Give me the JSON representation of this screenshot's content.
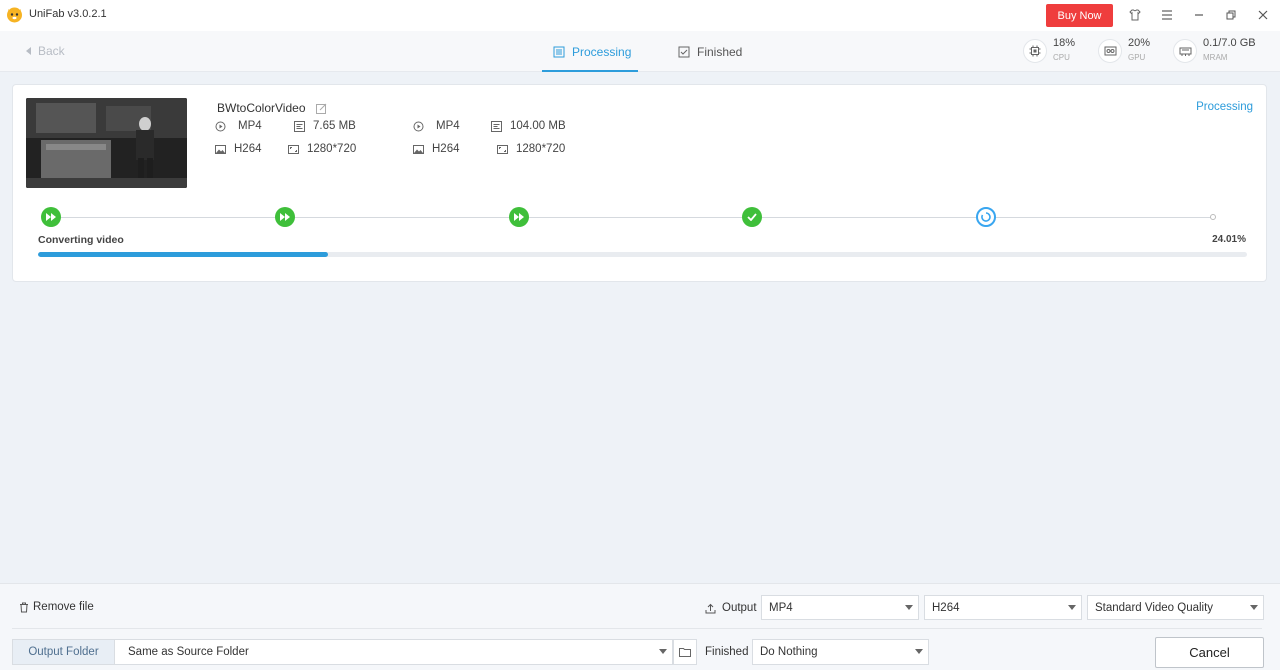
{
  "app": {
    "title": "UniFab v3.0.2.1",
    "buy_label": "Buy Now"
  },
  "nav": {
    "back_label": "Back",
    "tabs": [
      {
        "label": "Processing",
        "active": true
      },
      {
        "label": "Finished",
        "active": false
      }
    ]
  },
  "stats": {
    "cpu": {
      "value": "18%",
      "label": "CPU"
    },
    "gpu": {
      "value": "20%",
      "label": "GPU"
    },
    "vram": {
      "value": "0.1/7.0 GB",
      "label": "MRAM"
    }
  },
  "task": {
    "name": "BWtoColorVideo",
    "status": "Processing",
    "source": {
      "container": "MP4",
      "size": "7.65 MB",
      "codec": "H264",
      "resolution": "1280*720"
    },
    "output": {
      "container": "MP4",
      "size": "104.00 MB",
      "codec": "H264",
      "resolution": "1280*720"
    },
    "steps": [
      "done",
      "done",
      "done",
      "done",
      "current",
      "pending"
    ],
    "progress_label": "Converting video",
    "progress_text": "24.01%",
    "progress_value": 0.2401
  },
  "bottom": {
    "remove_label": "Remove file",
    "output_label": "Output",
    "format": "MP4",
    "codec": "H264",
    "quality": "Standard Video Quality",
    "output_folder_label": "Output Folder",
    "output_folder_value": "Same as Source Folder",
    "finished_label": "Finished",
    "finished_action": "Do Nothing",
    "cancel_label": "Cancel"
  },
  "colors": {
    "accent": "#2d9cdb",
    "buy": "#ef3d3d",
    "done": "#3fbf3a"
  }
}
